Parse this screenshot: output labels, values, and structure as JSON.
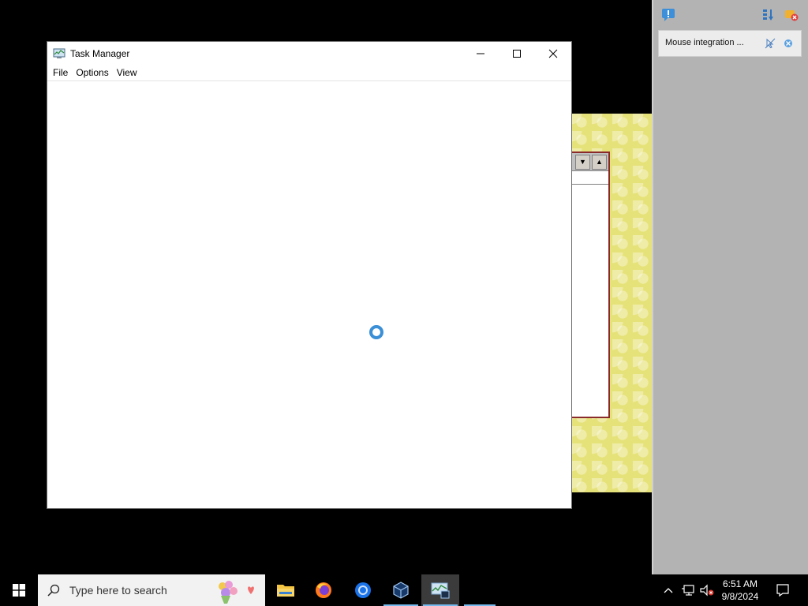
{
  "window": {
    "title": "Task Manager",
    "menu": [
      "File",
      "Options",
      "View"
    ]
  },
  "side_panel": {
    "notification": "Mouse integration ..."
  },
  "taskbar": {
    "search_placeholder": "Type here to search",
    "apps": [
      {
        "name": "file-explorer",
        "icon": "folder-icon"
      },
      {
        "name": "firefox",
        "icon": "firefox-icon"
      },
      {
        "name": "chrome",
        "icon": "chrome-icon"
      },
      {
        "name": "virtualbox",
        "icon": "virtualbox-icon"
      },
      {
        "name": "task-manager",
        "icon": "task-manager-icon",
        "active": true
      }
    ],
    "time": "6:51 AM",
    "date": "9/8/2024"
  },
  "colors": {
    "accent": "#0078d7",
    "spinner": "#3a8fd6",
    "honeycomb": "#e6e27a"
  }
}
